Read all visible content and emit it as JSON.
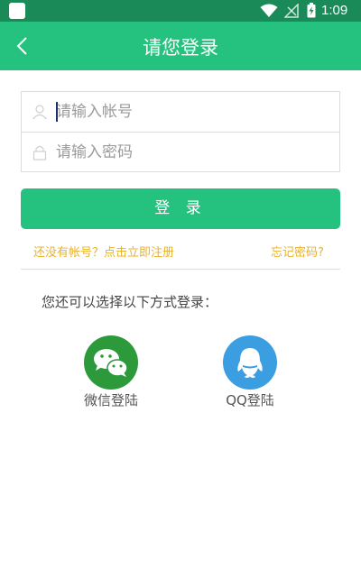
{
  "status_bar": {
    "time": "1:09",
    "icons": [
      "app-icon",
      "wifi-icon",
      "no-signal-icon",
      "battery-charging-icon"
    ]
  },
  "header": {
    "title": "请您登录",
    "back_icon": "chevron-left-icon"
  },
  "form": {
    "account_placeholder": "请输入帐号",
    "account_value": "",
    "account_icon": "user-icon",
    "password_placeholder": "请输入密码",
    "password_value": "",
    "password_icon": "lock-icon"
  },
  "login_button": "登 录",
  "links": {
    "register": "还没有帐号？点击立即注册",
    "forgot": "忘记密码?"
  },
  "other_login": {
    "prompt": "您还可以选择以下方式登录：",
    "options": [
      {
        "label": "微信登陆",
        "icon": "wechat-icon",
        "color": "#2c9a3b"
      },
      {
        "label": "QQ登陆",
        "icon": "qq-icon",
        "color": "#3b9ee0"
      }
    ]
  },
  "colors": {
    "status_bar": "#1a8a58",
    "primary": "#25c27f",
    "link": "#e8b22a"
  }
}
